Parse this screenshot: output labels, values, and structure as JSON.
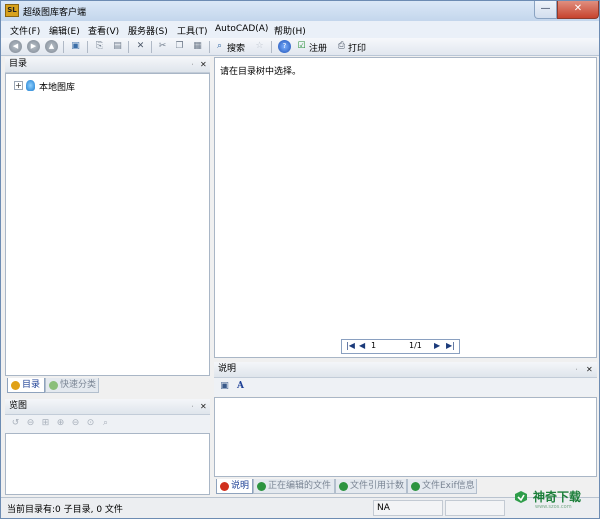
{
  "window": {
    "title": "超级图库客户端",
    "app_icon_text": "SL",
    "controls": {
      "minimize": "—",
      "maximize": "□",
      "close": "✕"
    }
  },
  "menubar": {
    "items": [
      {
        "label": "文件(F)"
      },
      {
        "label": "编辑(E)"
      },
      {
        "label": "查看(V)"
      },
      {
        "label": "服务器(S)"
      },
      {
        "label": "工具(T)"
      },
      {
        "label": "AutoCAD(A)"
      },
      {
        "label": "帮助(H)"
      }
    ]
  },
  "toolbar": {
    "search_label": "搜索",
    "register_label": "注册",
    "print_label": "打印"
  },
  "catalog_pane": {
    "title": "目录",
    "pin": "ᆞ",
    "close": "✕",
    "tree": [
      {
        "label": "本地图库",
        "expander": "+"
      }
    ],
    "tabs": [
      {
        "label": "目录",
        "active": true
      },
      {
        "label": "快速分类",
        "active": false
      }
    ]
  },
  "preview_pane": {
    "title": "览图",
    "pin": "ᆞ",
    "close": "✕"
  },
  "main_area": {
    "prompt": "请在目录树中选择。",
    "pager": {
      "current_input": "1",
      "page_indicator": "1/1"
    }
  },
  "description_pane": {
    "title": "说明",
    "pin": "ᆞ",
    "close": "✕",
    "format_label": "A",
    "tabs": [
      {
        "label": "说明",
        "active": true
      },
      {
        "label": "正在编辑的文件",
        "active": false
      },
      {
        "label": "文件引用计数",
        "active": false
      },
      {
        "label": "文件Exif信息",
        "active": false
      }
    ]
  },
  "statusbar": {
    "text": "当前目录有:0 子目录, 0 文件",
    "cell2": "NA"
  },
  "watermark": {
    "text": "神奇下载",
    "sub": "www.szos.com"
  },
  "colors": {
    "accent": "#1c3f95",
    "titlebar": "#c3d6ec",
    "close": "#c7432e"
  }
}
